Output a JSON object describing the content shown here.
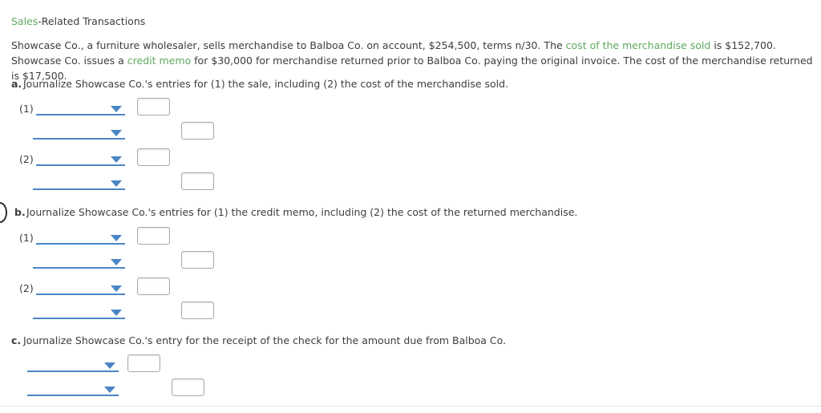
{
  "title": {
    "keyword": "Sales",
    "rest": "-Related Transactions"
  },
  "problem": {
    "part1": "Showcase Co., a furniture wholesaler, sells merchandise to Balboa Co. on account, $254,500, terms n/30. The ",
    "kw1": "cost of the merchandise sold",
    "part2": " is $152,700. Showcase Co. issues a ",
    "kw2": "credit memo",
    "part3": " for $30,000 for merchandise returned prior to Balboa Co. paying the original invoice. The cost of the merchandise returned is $17,500."
  },
  "sections": [
    {
      "letter": "a.",
      "text": "Journalize Showcase Co.'s entries for (1) the sale, including (2) the cost of the merchandise sold.",
      "entries": [
        {
          "number": "(1)",
          "debit_account": "",
          "debit_amount": "",
          "credit_account": "",
          "credit_amount": ""
        },
        {
          "number": "(2)",
          "debit_account": "",
          "debit_amount": "",
          "credit_account": "",
          "credit_amount": ""
        }
      ]
    },
    {
      "letter": "b.",
      "text": "Journalize Showcase Co.'s entries for (1) the credit memo, including (2) the cost of the returned merchandise.",
      "entries": [
        {
          "number": "(1)",
          "debit_account": "",
          "debit_amount": "",
          "credit_account": "",
          "credit_amount": ""
        },
        {
          "number": "(2)",
          "debit_account": "",
          "debit_amount": "",
          "credit_account": "",
          "credit_amount": ""
        }
      ]
    },
    {
      "letter": "c.",
      "text": "Journalize Showcase Co.'s entry for the receipt of the check for the amount due from Balboa Co.",
      "entries": [
        {
          "number": "",
          "debit_account": "",
          "debit_amount": "",
          "credit_account": "",
          "credit_amount": ""
        }
      ]
    }
  ],
  "colors": {
    "keyword_green": "#5fa85f",
    "rule_blue": "#4a86c4",
    "text_gray": "#3d3d3d",
    "box_border": "#a9a9a9"
  }
}
